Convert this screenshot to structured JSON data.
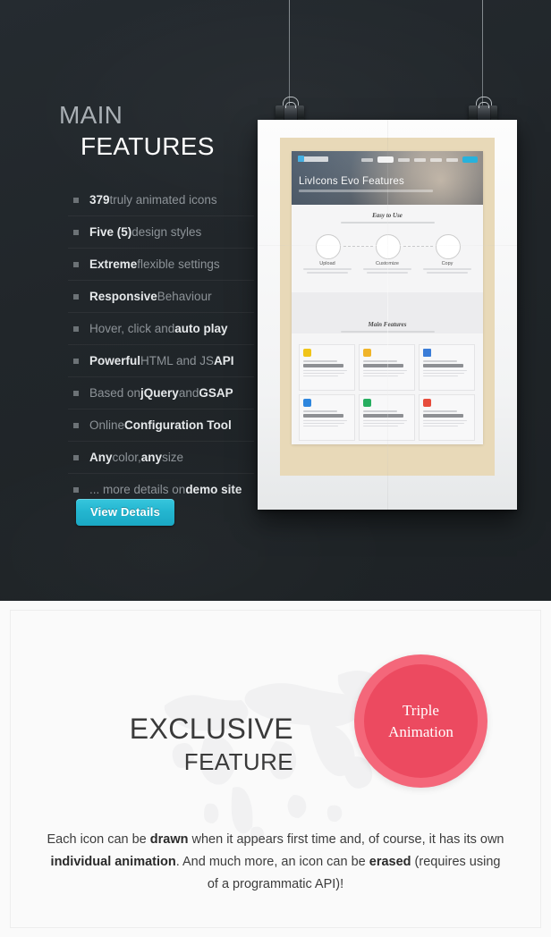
{
  "hero": {
    "headline_line1": "MAIN",
    "headline_line2": "FEATURES",
    "features": [
      {
        "strong": "379",
        "rest": " truly animated icons",
        "order": "strong-first"
      },
      {
        "strong": "Five (5)",
        "rest": " design styles",
        "order": "strong-first"
      },
      {
        "strong": "Extreme",
        "rest": " flexible settings",
        "order": "strong-first"
      },
      {
        "strong": "Responsive",
        "rest": " Behaviour",
        "order": "strong-first"
      },
      {
        "strong": "auto play",
        "rest": "Hover, click and ",
        "order": "light-first"
      },
      {
        "strong": "Powerful",
        "rest": " HTML and JS ",
        "order": "strong-first",
        "tail_strong": "API"
      },
      {
        "strong": "jQuery",
        "rest": "Based on ",
        "order": "light-first",
        "tail_light": " and ",
        "tail_strong": "GSAP"
      },
      {
        "strong": "Configuration Tool",
        "rest": "Online ",
        "order": "light-first"
      },
      {
        "strong": "Any",
        "rest": " color, ",
        "order": "strong-first",
        "tail_strong": "any",
        "tail_light": " size"
      },
      {
        "strong": "demo site",
        "rest": "... more details on ",
        "order": "light-first"
      }
    ],
    "button_label": "View Details",
    "bullet_icon": "square-bullet-icon",
    "clip_icon": "binder-clip-icon",
    "accent_button_color": "#24b6d0",
    "background_color": "#22272b"
  },
  "poster": {
    "site_title": "LivIcons Evo Features",
    "nav_logo": "livicons-logo-icon",
    "section1_title": "Easy to Use",
    "steps": [
      {
        "label": "Upload",
        "icon": "upload-icon"
      },
      {
        "label": "Customize",
        "icon": "sliders-icon"
      },
      {
        "label": "Copy",
        "icon": "clipboard-icon"
      }
    ],
    "section2_title": "Main Features",
    "cards": [
      {
        "icon": "magic-wand-icon",
        "kicker": "Based on",
        "title": "GSAP"
      },
      {
        "icon": "bell-icon",
        "kicker": "More than",
        "title": "340 animated icons"
      },
      {
        "icon": "grid-icon",
        "kicker": "Frequently",
        "title": "Rebuilt from scratch"
      },
      {
        "icon": "flag-icon",
        "kicker": "Triple",
        "title": "Animation"
      },
      {
        "icon": "gear-icon",
        "kicker": "Incredible",
        "title": "Settings"
      },
      {
        "icon": "pencil-icon",
        "kicker": "Five Simple",
        "title": "Design"
      }
    ],
    "paper_color": "#e8d9b8"
  },
  "exclusive": {
    "title_line1": "EXCLUSIVE",
    "title_line2": "FEATURE",
    "badge_line1": "Triple",
    "badge_line2": "Animation",
    "badge_color": "#ec4a60",
    "description": {
      "p1": "Each icon can be ",
      "b1": "drawn",
      "p2": " when it appears first time and, of course, it has its own ",
      "b2": "individual animation",
      "p3": ". And much more, an icon can be ",
      "b3": "erased",
      "p4": " (requires using of a programmatic API)!"
    }
  }
}
